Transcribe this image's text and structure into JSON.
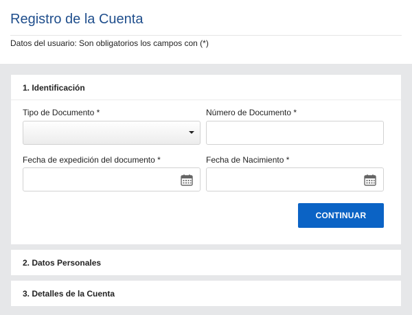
{
  "header": {
    "title": "Registro de la Cuenta",
    "subtitle": "Datos del usuario: Son obligatorios los campos con (*)"
  },
  "sections": [
    {
      "title": "1. Identificación"
    },
    {
      "title": "2. Datos Personales"
    },
    {
      "title": "3. Detalles de la Cuenta"
    }
  ],
  "form": {
    "document_type": {
      "label": "Tipo de Documento *",
      "value": ""
    },
    "document_number": {
      "label": "Número de Documento *",
      "value": ""
    },
    "issue_date": {
      "label": "Fecha de expedición del documento *",
      "value": "",
      "icon": "calendar-icon"
    },
    "birth_date": {
      "label": "Fecha de Nacimiento *",
      "value": "",
      "icon": "calendar-icon"
    },
    "continue_label": "CONTINUAR"
  },
  "colors": {
    "title": "#1f4e8c",
    "accent": "#0b63c5",
    "background_gray": "#e6e7e9"
  }
}
